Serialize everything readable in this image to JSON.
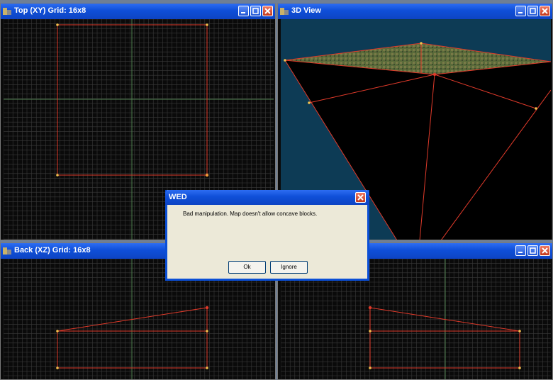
{
  "windows": {
    "top": {
      "title": "Top (XY) Grid: 16x8"
    },
    "view3d": {
      "title": "3D View"
    },
    "back": {
      "title": "Back (XZ) Grid: 16x8"
    },
    "side": {
      "title": ""
    }
  },
  "dialog": {
    "title": "WED",
    "message": "Bad manipulation. Map doesn't allow concave blocks.",
    "ok_label": "Ok",
    "ignore_label": "Ignore"
  },
  "colors": {
    "grid": "#3a3a3a",
    "axis": "#3f6e3f",
    "edge": "#e03a2a",
    "vertex": "#f2c14e",
    "view3d_bg": "#0d3b55",
    "titlebar": "#0f4fd8"
  },
  "icons": {
    "window": "wed-app-icon",
    "minimize": "minimize-icon",
    "maximize": "maximize-icon",
    "close": "close-icon"
  }
}
